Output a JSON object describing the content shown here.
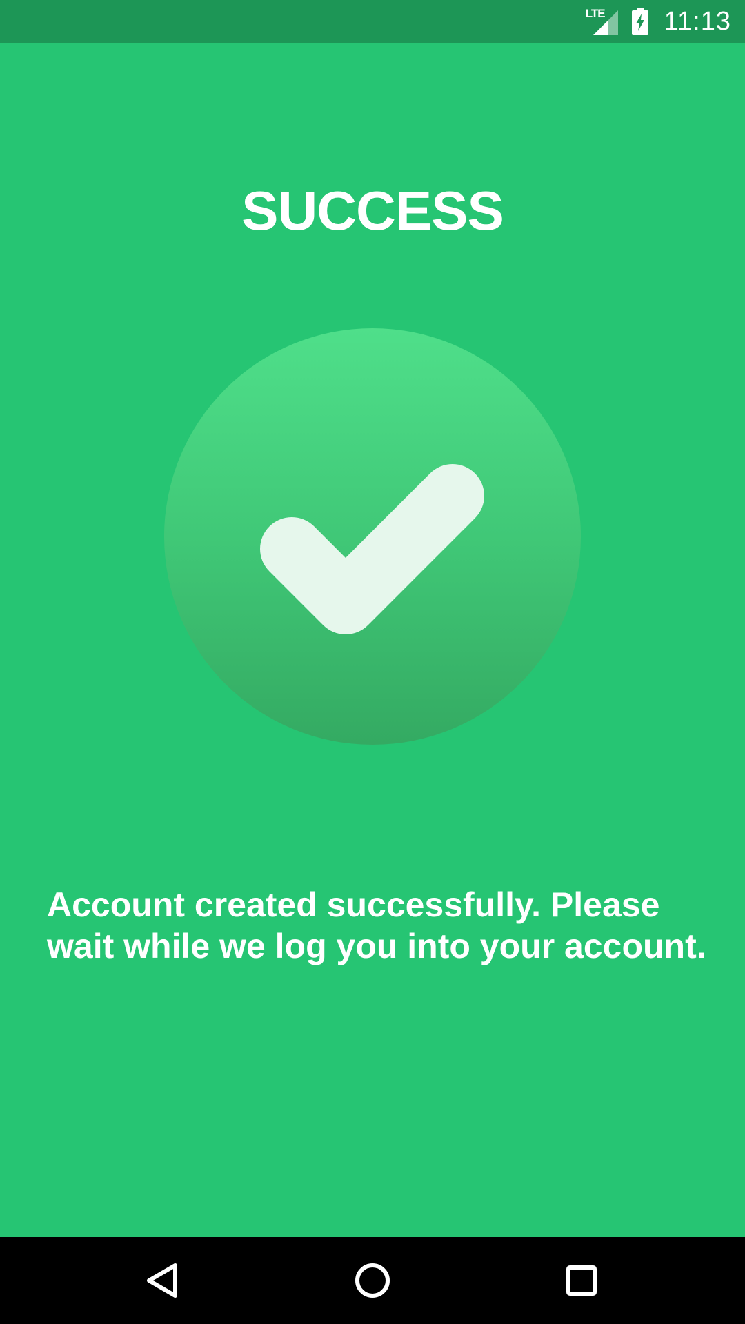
{
  "status_bar": {
    "network_label": "LTE",
    "time": "11:13",
    "icons": [
      "lte-signal-icon",
      "battery-charging-icon"
    ]
  },
  "main": {
    "title": "SUCCESS",
    "icon": "checkmark-icon",
    "message": "Account created successfully. Please wait while we log you into your account."
  },
  "nav_bar": {
    "icons": [
      "back-icon",
      "home-icon",
      "recents-icon"
    ]
  },
  "colors": {
    "background": "#26c573",
    "status_bar": "#1d9656",
    "circle_top": "#4fdf8a",
    "circle_bottom": "#34aa62",
    "text": "#ffffff",
    "nav_bar": "#000000"
  }
}
